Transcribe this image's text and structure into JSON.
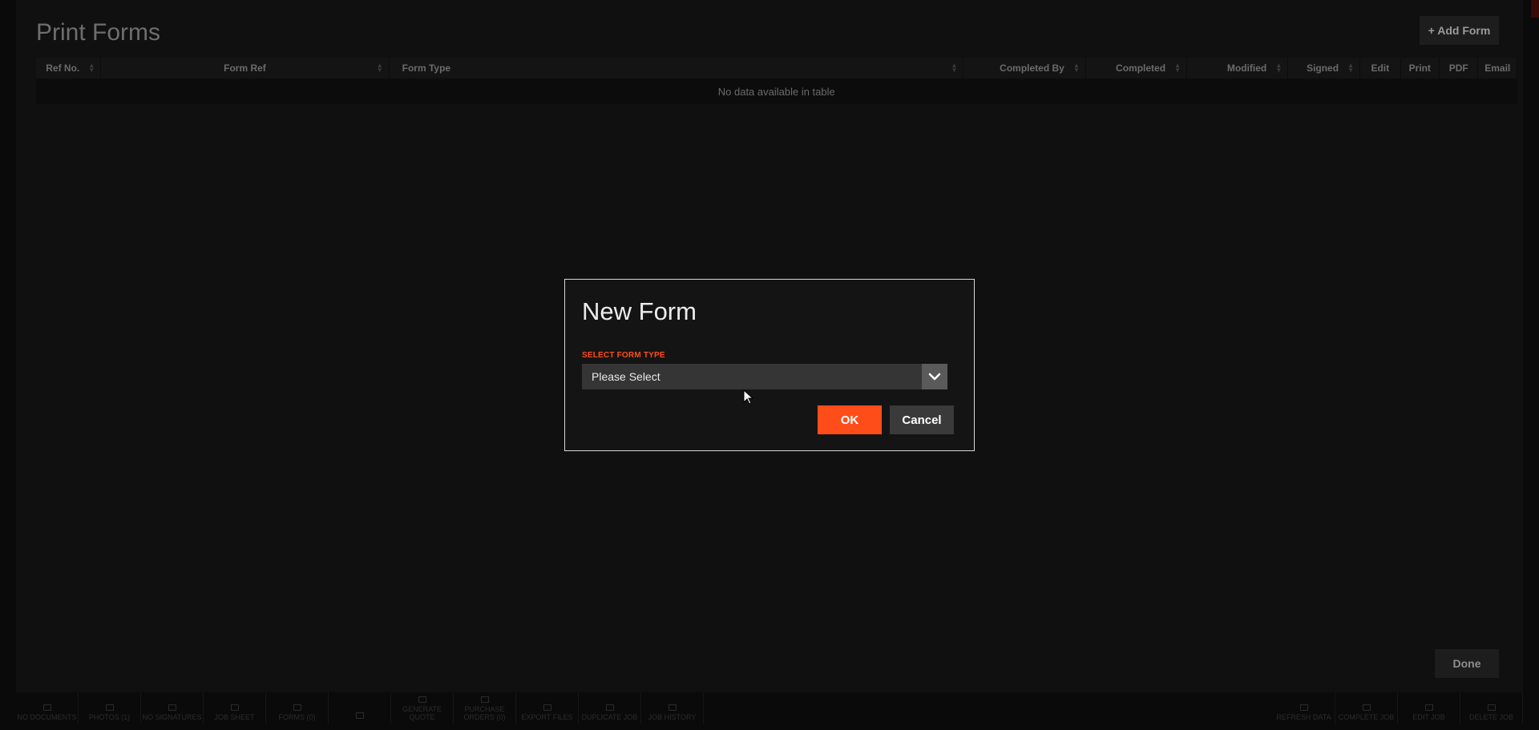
{
  "panel": {
    "title": "Print Forms",
    "add_form_label": "+ Add Form",
    "done_label": "Done",
    "table": {
      "columns": [
        "Ref No.",
        "Form Ref",
        "Form Type",
        "Completed By",
        "Completed",
        "Modified",
        "Signed",
        "Edit",
        "Print",
        "PDF",
        "Email"
      ],
      "empty_message": "No data available in table"
    }
  },
  "modal": {
    "title": "New Form",
    "field_label": "SELECT FORM TYPE",
    "select_value": "Please Select",
    "ok_label": "OK",
    "cancel_label": "Cancel"
  },
  "toolbar": {
    "left": [
      "NO DOCUMENTS",
      "PHOTOS (1)",
      "NO SIGNATURES",
      "JOB SHEET",
      "FORMS (0)",
      "",
      "GENERATE QUOTE",
      "PURCHASE ORDERS (0)",
      "EXPORT FILES",
      "DUPLICATE JOB",
      "JOB HISTORY"
    ],
    "right": [
      "REFRESH DATA",
      "COMPLETE JOB",
      "EDIT JOB",
      "DELETE JOB"
    ]
  },
  "colors": {
    "accent": "#ff4d1a",
    "modal_border": "#d8d8d8",
    "select_bg": "#353535",
    "cancel_bg": "#3a3a3a"
  },
  "icons": [
    "chevron-down-icon",
    "sort-icon",
    "mouse-cursor-icon"
  ]
}
